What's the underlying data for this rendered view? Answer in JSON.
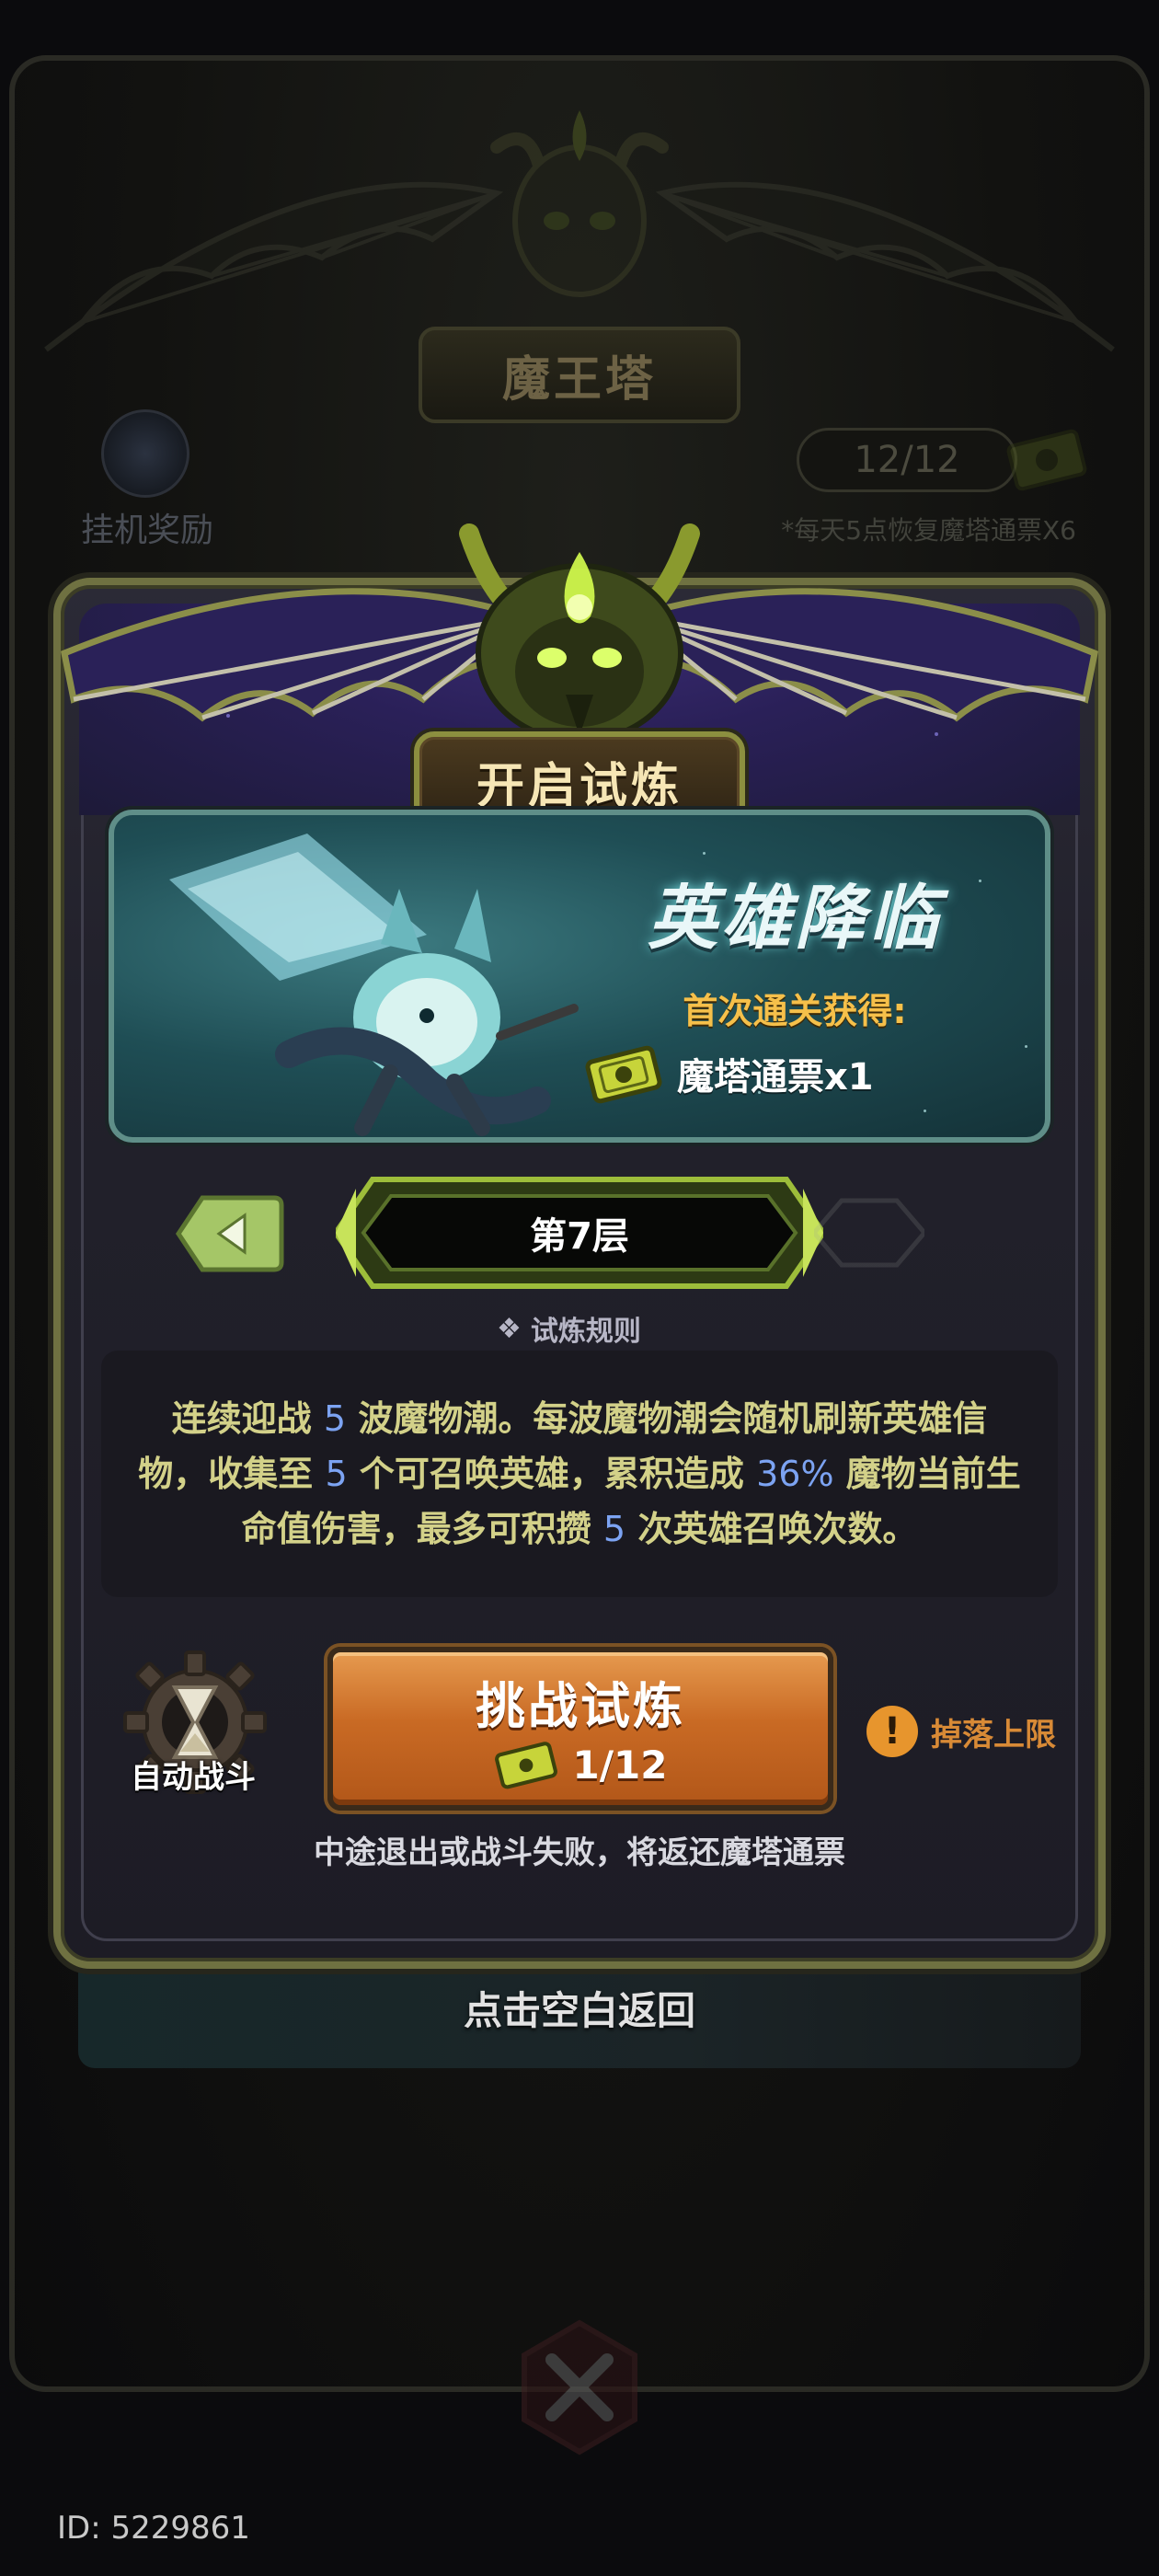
{
  "background": {
    "tower_title": "魔王塔",
    "idle_reward_label": "挂机奖励",
    "ticket_count": "12/12",
    "ticket_note": "*每天5点恢复魔塔通票X6"
  },
  "modal": {
    "title": "开启试炼",
    "banner": {
      "title": "英雄降临",
      "reward_label": "首次通关获得:",
      "reward_item": "魔塔通票x1"
    },
    "floor": {
      "label": "第7层"
    },
    "rules": {
      "link_label": "试炼规则",
      "text_parts": [
        "连续迎战 ",
        "5",
        " 波魔物潮。每波魔物潮会随机刷新英雄信物，收集至 ",
        "5",
        " 个可召唤英雄，累积造成 ",
        "36%",
        " 魔物当前生命值伤害，最多可积攒 ",
        "5",
        " 次英雄召唤次数。"
      ]
    },
    "auto_battle_label": "自动战斗",
    "challenge": {
      "title": "挑战试炼",
      "cost": "1/12"
    },
    "drop_limit": {
      "icon": "!",
      "label": "掉落上限"
    },
    "refund_note": "中途退出或战斗失败，将返还魔塔通票"
  },
  "tap_return": "点击空白返回",
  "id_label": "ID: 5229861",
  "colors": {
    "accent_gold": "#f6c04a",
    "highlight_blue": "#7ca3f2",
    "rule_text": "#d3d189",
    "button_orange": "#c96a24",
    "frame_olive": "#6f7141"
  }
}
